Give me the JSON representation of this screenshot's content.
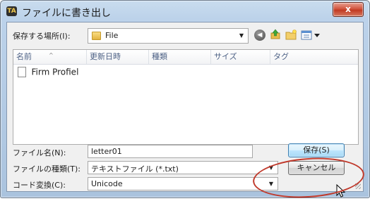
{
  "window": {
    "title": "ファイルに書き出し",
    "app_icon_text": "TA",
    "close_label": "x"
  },
  "location": {
    "label": "保存する場所(I):",
    "value": "File"
  },
  "toolbar": {
    "back_icon": "back-arrow-icon",
    "up_icon": "up-folder-icon",
    "new_folder_icon": "new-folder-icon",
    "views_icon": "views-menu-icon"
  },
  "file_list": {
    "columns": [
      "名前",
      "更新日時",
      "種類",
      "サイズ",
      "タグ"
    ],
    "items": [
      {
        "name": "Firm Profiel",
        "icon": "document-icon"
      }
    ]
  },
  "filename": {
    "label": "ファイル名(N):",
    "value": "letter01"
  },
  "filetype": {
    "label": "ファイルの種類(T):",
    "value": "テキストファイル (*.txt)"
  },
  "encoding": {
    "label": "コード変換(C):",
    "value": "Unicode"
  },
  "buttons": {
    "save": "保存(S)",
    "cancel": "キャンセル"
  },
  "colors": {
    "highlight": "#c0392b",
    "accent": "#3c7fb1"
  }
}
